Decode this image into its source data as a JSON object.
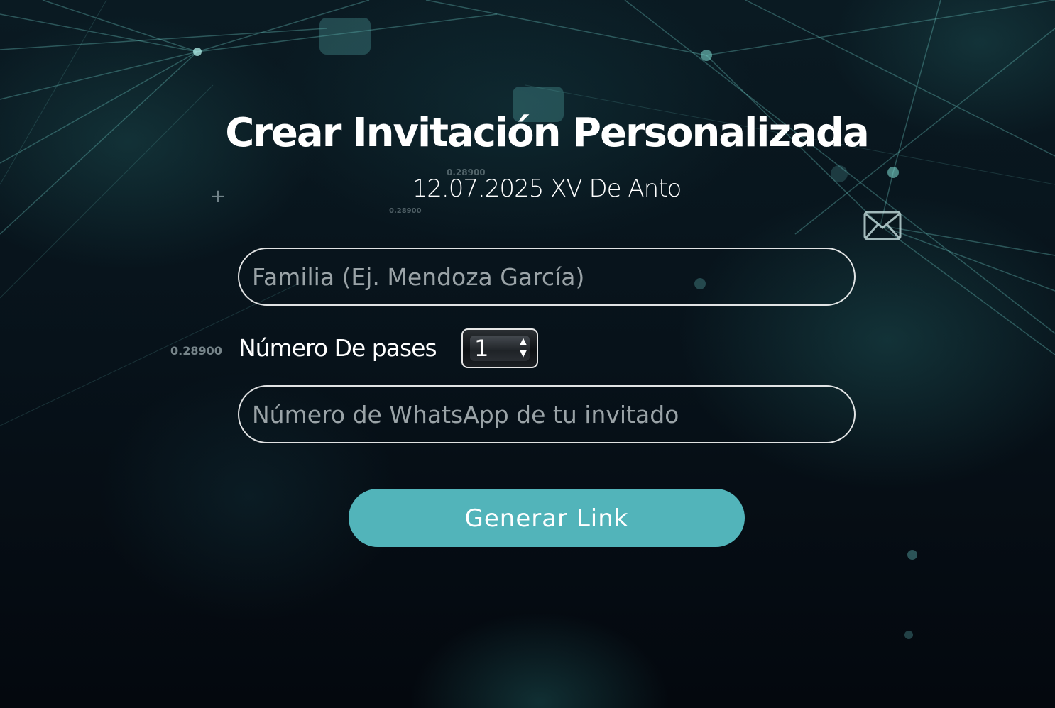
{
  "header": {
    "title": "Crear Invitación Personalizada",
    "subtitle": "12.07.2025 XV De Anto"
  },
  "form": {
    "familia": {
      "value": "",
      "placeholder": "Familia (Ej. Mendoza García)"
    },
    "passes": {
      "label": "Número De pases",
      "value": "1",
      "up_icon": "▲",
      "down_icon": "▼"
    },
    "whatsapp": {
      "value": "",
      "placeholder": "Número de WhatsApp de tu invitado"
    },
    "submit_label": "Generar Link"
  },
  "background": {
    "decorative_numbers": [
      "0.28900",
      "0.28900",
      "0.28900"
    ],
    "plus_glyph": "+",
    "icons": [
      "envelope-icon",
      "plus-icon"
    ]
  },
  "colors": {
    "accent": "#52b4ba",
    "background": "#050b12",
    "text": "#ffffff",
    "placeholder": "#9aa3a7"
  }
}
